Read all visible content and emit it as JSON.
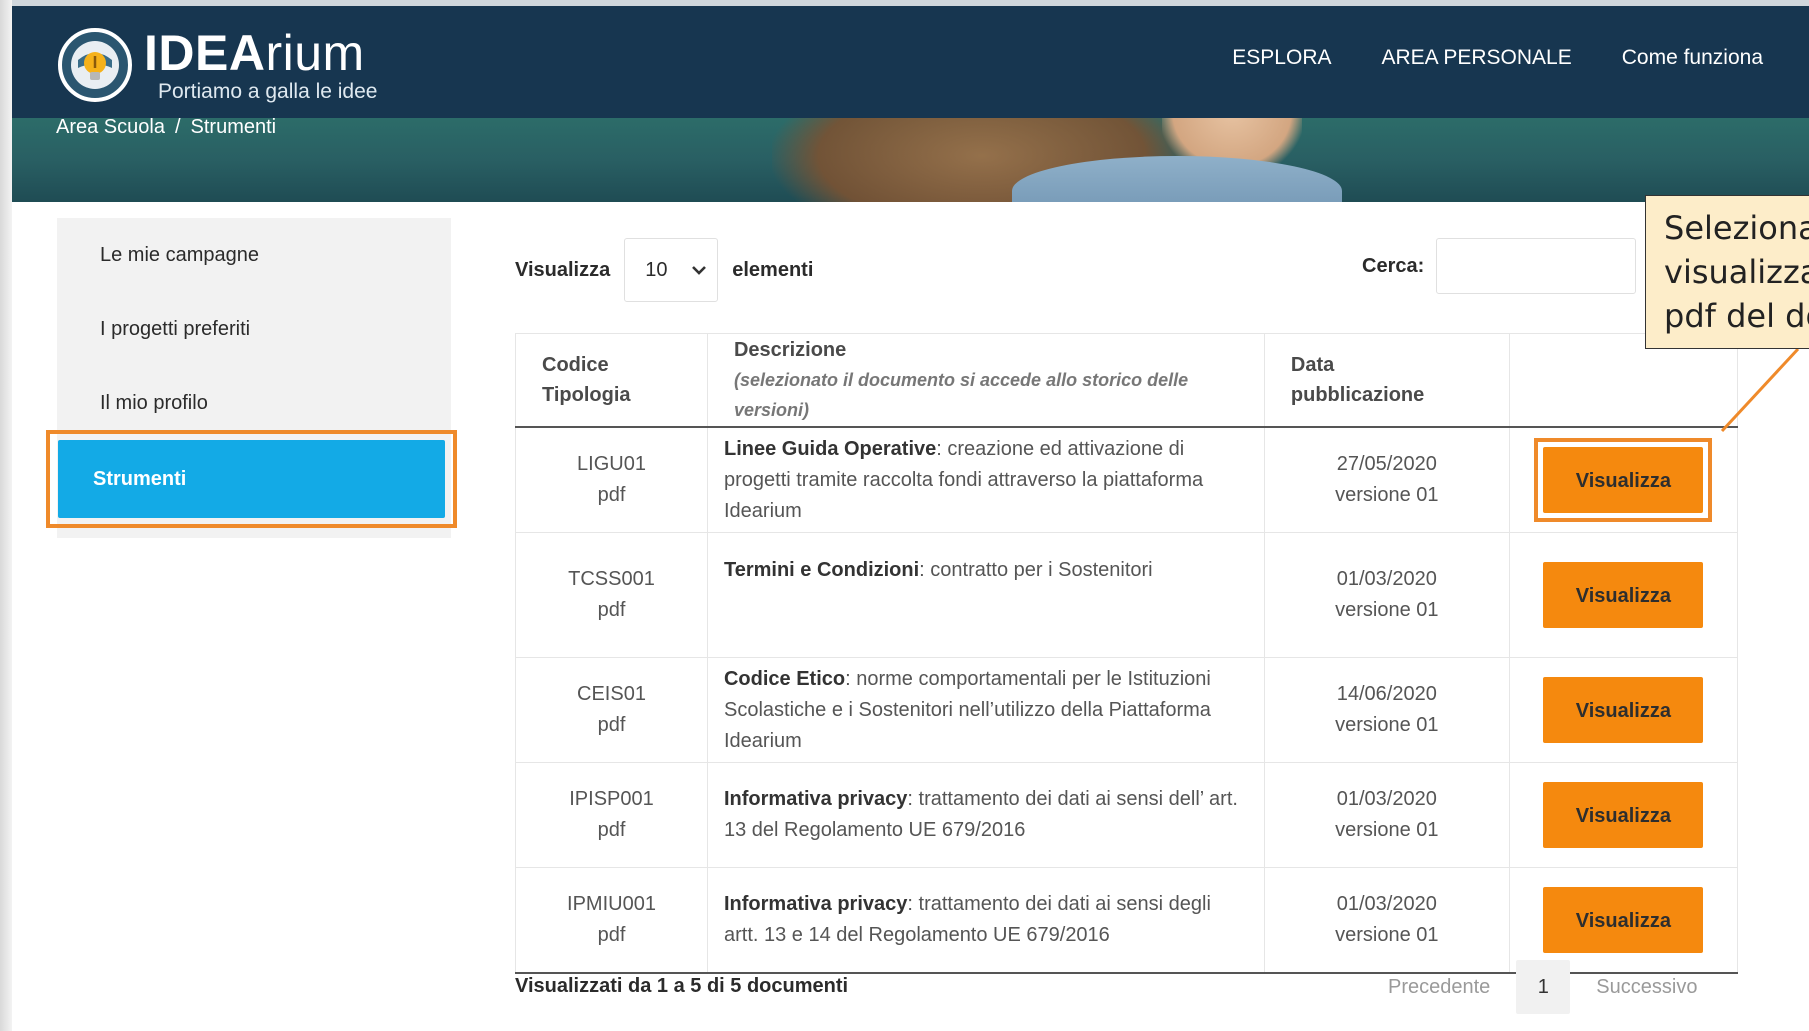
{
  "header": {
    "logo_title_bold": "IDEA",
    "logo_title_rest": "rium",
    "logo_subtitle": "Portiamo a galla le idee",
    "nav": [
      "ESPLORA",
      "AREA PERSONALE",
      "Come funziona"
    ],
    "breadcrumb": [
      "Area Scuola",
      "Strumenti"
    ],
    "breadcrumb_separator": "/"
  },
  "sidebar": {
    "items": [
      {
        "label": "Le mie campagne"
      },
      {
        "label": "I progetti preferiti"
      },
      {
        "label": "Il mio profilo"
      },
      {
        "label": "Strumenti",
        "active": true
      }
    ]
  },
  "controls": {
    "show_label": "Visualizza",
    "page_size": "10",
    "elements_label": "elementi",
    "search_label": "Cerca:",
    "search_value": ""
  },
  "table": {
    "headers": {
      "code_line1": "Codice",
      "code_line2": "Tipologia",
      "desc": "Descrizione",
      "desc_note": "(selezionato il documento si accede allo storico delle versioni)",
      "date_line1": "Data",
      "date_line2": "pubblicazione",
      "action": ""
    },
    "rows": [
      {
        "code": "LIGU01",
        "type": "pdf",
        "title": "Linee Guida Operative",
        "desc": ": creazione ed attivazione di progetti tramite raccolta fondi attraverso la piattaforma Idearium",
        "date": "27/05/2020",
        "version": "versione 01",
        "action": "Visualizza"
      },
      {
        "code": "TCSS001",
        "type": "pdf",
        "title": "Termini e Condizioni",
        "desc": ": contratto per i Sostenitori",
        "date": "01/03/2020",
        "version": "versione 01",
        "action": "Visualizza"
      },
      {
        "code": "CEIS01",
        "type": "pdf",
        "title": "Codice Etico",
        "desc": ": norme comportamentali per le Istituzioni Scolastiche e i Sostenitori nell’utilizzo della Piattaforma Idearium",
        "date": "14/06/2020",
        "version": "versione 01",
        "action": "Visualizza"
      },
      {
        "code": "IPISP001",
        "type": "pdf",
        "title": "Informativa privacy",
        "desc": ": trattamento dei dati ai sensi dell’ art. 13 del Regolamento UE 679/2016",
        "date": "01/03/2020",
        "version": "versione 01",
        "action": "Visualizza"
      },
      {
        "code": "IPMIU001",
        "type": "pdf",
        "title": "Informativa privacy",
        "desc": ": trattamento dei dati ai sensi degli artt. 13 e 14 del Regolamento UE 679/2016",
        "date": "01/03/2020",
        "version": "versione 01",
        "action": "Visualizza"
      }
    ]
  },
  "footer": {
    "info": "Visualizzati da 1 a 5 di 5 documenti",
    "prev": "Precedente",
    "current_page": "1",
    "next": "Successivo"
  },
  "callout": {
    "lines": [
      "Seleziona",
      "visualizza",
      "pdf del do"
    ]
  },
  "colors": {
    "header_bg": "#173650",
    "active_tab": "#13aae6",
    "button": "#f5890e",
    "highlight": "#ef8a2a",
    "callout_bg": "#fdedc9"
  }
}
